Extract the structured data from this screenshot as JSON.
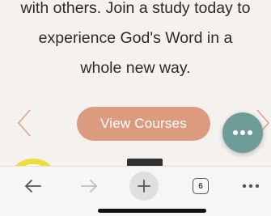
{
  "intro_text": {
    "line1": "with others. Join a study today to",
    "line2": "experience God's Word in a",
    "line3": "whole new way."
  },
  "cta": {
    "label": "View Courses"
  },
  "colors": {
    "cta_bg": "#dc9b7f",
    "fab_bg": "#6e9c98",
    "arrow": "#e2a58b",
    "highlight": "#ecdd3a"
  },
  "icons": {
    "prev": "chevron-left-icon",
    "next": "chevron-right-icon",
    "fab": "more-horizontal-icon",
    "back": "back-arrow-icon",
    "forward": "forward-arrow-icon",
    "new_tab": "plus-icon",
    "tabs": "tabs-icon",
    "menu": "more-icon"
  },
  "toolbar": {
    "tab_count": "6"
  }
}
